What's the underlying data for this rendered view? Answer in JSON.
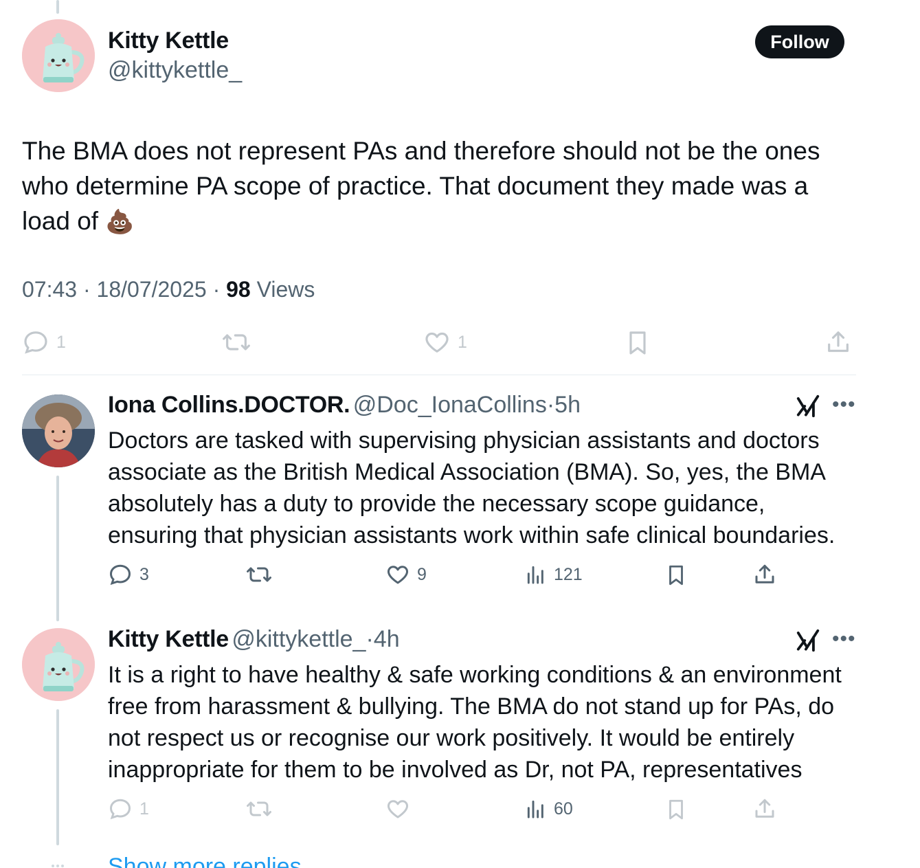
{
  "main_tweet": {
    "author_name": "Kitty Kettle",
    "handle": "@kittykettle_",
    "follow_label": "Follow",
    "text": "The BMA does not represent PAs and therefore should not be the ones who determine PA scope of practice. That document they made was a load of",
    "emoji": "💩",
    "time": "07:43",
    "date": "18/07/2025",
    "views_count": "98",
    "views_label": "Views",
    "actions": {
      "replies": "1",
      "likes": "1"
    }
  },
  "replies": [
    {
      "author_name": "Iona Collins.DOCTOR.",
      "handle": "@Doc_IonaCollins",
      "age": "5h",
      "text": "Doctors are tasked with supervising physician assistants and doctors associate as the British Medical Association (BMA). So, yes, the BMA absolutely has a duty to provide the necessary scope guidance, ensuring that physician assistants work within safe clinical boundaries.",
      "actions": {
        "replies": "3",
        "likes": "9",
        "views": "121"
      }
    },
    {
      "author_name": "Kitty Kettle",
      "handle": "@kittykettle_",
      "age": "4h",
      "text": "It is a right to have healthy & safe working conditions & an environment free from harassment & bullying. The BMA do not stand up for PAs, do not respect us or recognise our work positively. It would be entirely inappropriate for them to be involved as Dr, not PA, representatives",
      "actions": {
        "replies": "1",
        "views": "60"
      }
    }
  ],
  "more_link": "Show more replies",
  "icons": [
    "reply-icon",
    "retweet-icon",
    "like-icon",
    "views-icon",
    "bookmark-icon",
    "share-icon",
    "grok-icon",
    "more-icon"
  ],
  "colors": {
    "text": "#0f1419",
    "muted": "#536471",
    "link": "#1d9bf0",
    "line": "#cfd9de",
    "button": "#0f1419"
  }
}
